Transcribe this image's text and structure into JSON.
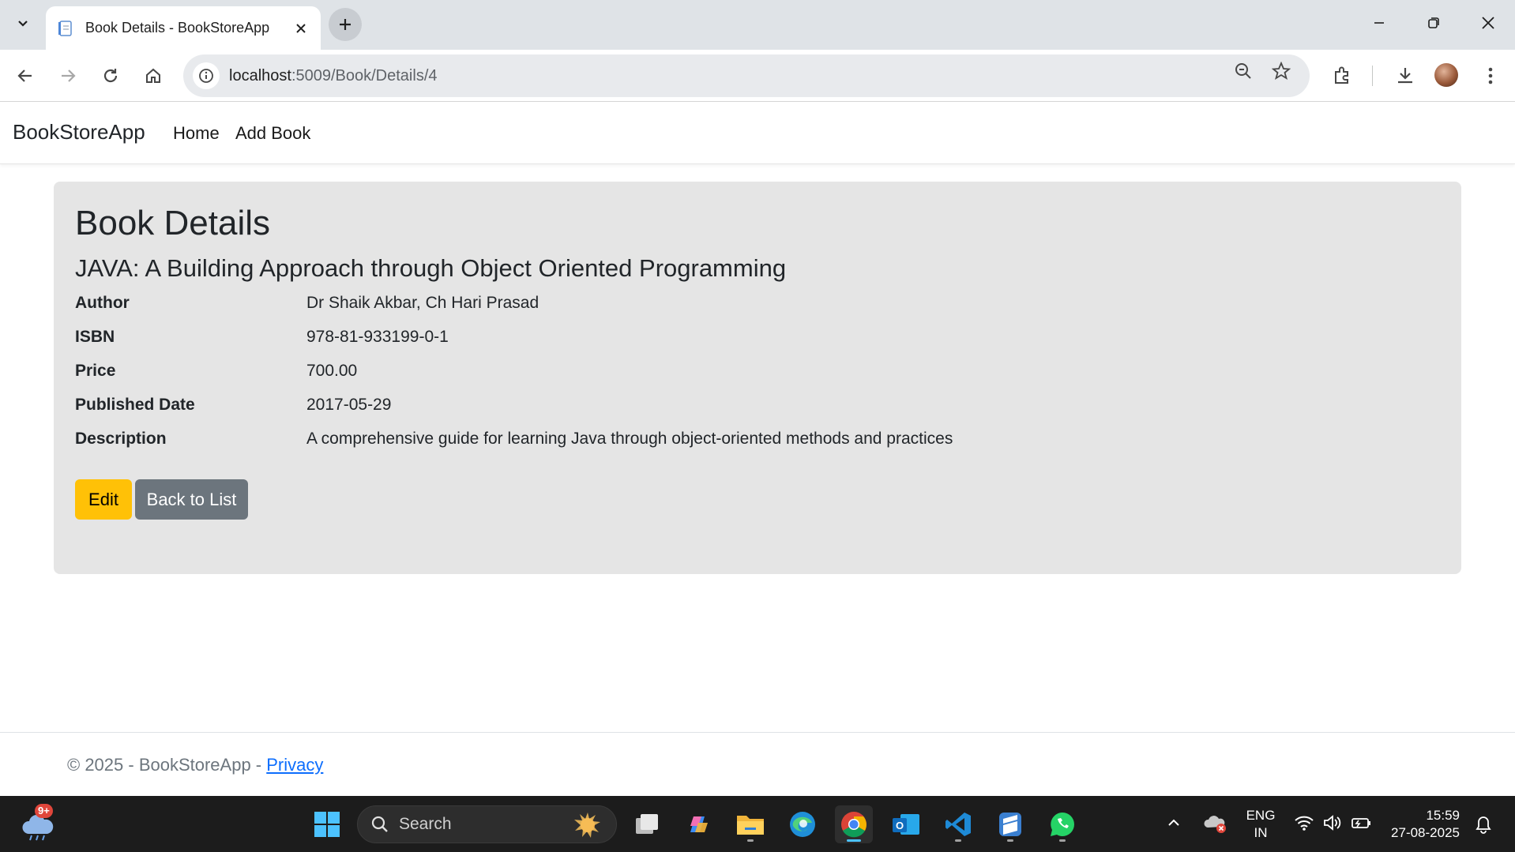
{
  "browser": {
    "tab_title": "Book Details - BookStoreApp",
    "url_host": "localhost",
    "url_rest": ":5009/Book/Details/4"
  },
  "site": {
    "brand": "BookStoreApp",
    "nav": [
      "Home",
      "Add Book"
    ]
  },
  "details": {
    "heading": "Book Details",
    "book_title": "JAVA: A Building Approach through Object Oriented Programming",
    "fields": [
      {
        "label": "Author",
        "value": "Dr Shaik Akbar, Ch Hari Prasad"
      },
      {
        "label": "ISBN",
        "value": "978-81-933199-0-1"
      },
      {
        "label": "Price",
        "value": "700.00"
      },
      {
        "label": "Published Date",
        "value": "2017-05-29"
      },
      {
        "label": "Description",
        "value": "A comprehensive guide for learning Java through object-oriented methods and practices"
      }
    ],
    "edit_label": "Edit",
    "back_label": "Back to List"
  },
  "footer": {
    "text": "© 2025 - BookStoreApp - ",
    "privacy": "Privacy"
  },
  "taskbar": {
    "search_label": "Search",
    "weather_badge": "9+",
    "lang_top": "ENG",
    "lang_bottom": "IN",
    "time": "15:59",
    "date": "27-08-2025"
  },
  "colors": {
    "edit_button": "#ffc107",
    "back_button": "#6c757d",
    "card_bg": "#e5e5e5",
    "link": "#0d6efd"
  }
}
